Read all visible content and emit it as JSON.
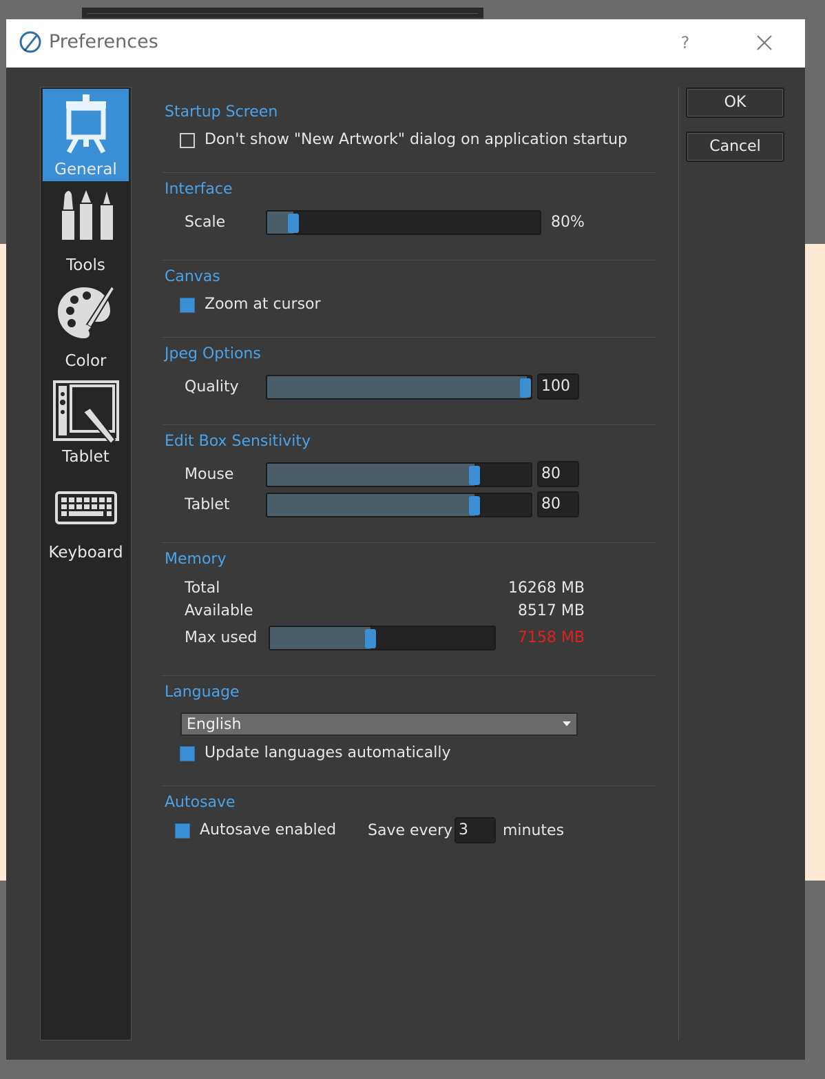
{
  "window": {
    "title": "Preferences",
    "help": "?"
  },
  "sidebar": {
    "items": [
      {
        "label": "General",
        "icon": "easel-icon",
        "active": true
      },
      {
        "label": "Tools",
        "icon": "brushes-icon"
      },
      {
        "label": "Color",
        "icon": "palette-icon"
      },
      {
        "label": "Tablet",
        "icon": "tablet-icon"
      },
      {
        "label": "Keyboard",
        "icon": "keyboard-icon"
      }
    ]
  },
  "startup": {
    "title": "Startup Screen",
    "dont_show_label": "Don't show \"New Artwork\" dialog on application startup",
    "dont_show_checked": false
  },
  "interface": {
    "title": "Interface",
    "scale_label": "Scale",
    "scale_value": "80%",
    "scale_fraction": 0.1
  },
  "canvas": {
    "title": "Canvas",
    "zoom_label": "Zoom at cursor",
    "zoom_checked": true
  },
  "jpeg": {
    "title": "Jpeg Options",
    "quality_label": "Quality",
    "quality_value": "100",
    "quality_fraction": 1.0
  },
  "edit_box": {
    "title": "Edit Box Sensitivity",
    "mouse_label": "Mouse",
    "mouse_value": "80",
    "mouse_fraction": 0.8,
    "tablet_label": "Tablet",
    "tablet_value": "80",
    "tablet_fraction": 0.8
  },
  "memory": {
    "title": "Memory",
    "total_label": "Total",
    "total_value": "16268 MB",
    "available_label": "Available",
    "available_value": "8517 MB",
    "max_used_label": "Max used",
    "max_used_value": "7158 MB",
    "max_used_fraction": 0.44,
    "max_used_color": "#e02020"
  },
  "language": {
    "title": "Language",
    "selected": "English",
    "update_label": "Update languages automatically",
    "update_checked": true
  },
  "autosave": {
    "title": "Autosave",
    "enabled_label": "Autosave enabled",
    "enabled_checked": true,
    "save_every_label": "Save every",
    "interval_value": "3",
    "minutes_label": "minutes"
  },
  "buttons": {
    "ok": "OK",
    "cancel": "Cancel"
  },
  "colors": {
    "accent": "#3b8fd4",
    "section_title": "#4aa3e8",
    "dialog_bg": "#3a3a3a",
    "sidebar_bg": "#262626"
  }
}
